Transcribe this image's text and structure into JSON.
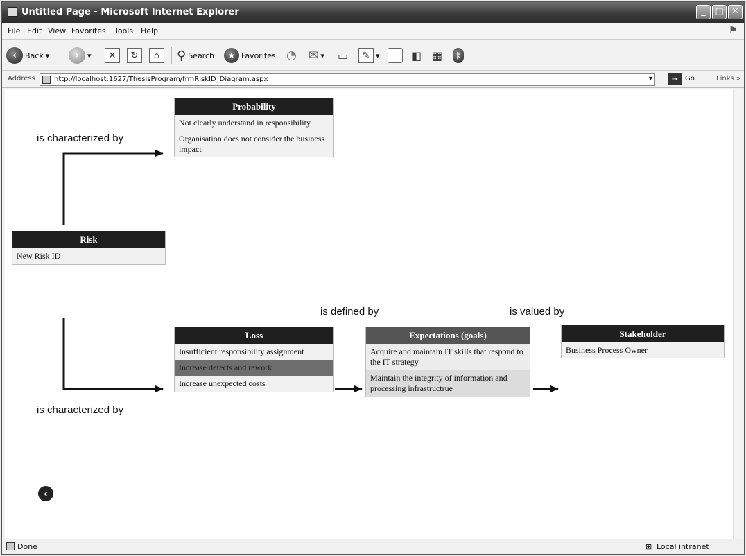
{
  "window": {
    "title": "Untitled Page - Microsoft Internet Explorer",
    "buttons": [
      "_",
      "□",
      "✕"
    ]
  },
  "menu": [
    "File",
    "Edit",
    "View",
    "Favorites",
    "Tools",
    "Help"
  ],
  "toolbar": {
    "back": "Back",
    "search": "Search",
    "favorites": "Favorites"
  },
  "address": {
    "label": "Address",
    "url": "http://localhost:1627/ThesisProgram/frmRiskID_Diagram.aspx",
    "go": "Go",
    "links": "Links »"
  },
  "diagram": {
    "risk": {
      "title": "Risk",
      "rows": [
        "New Risk ID"
      ]
    },
    "probability": {
      "title": "Probability",
      "rows": [
        "Not clearly understand in responsibility",
        "Organisation does not consider the business impact"
      ]
    },
    "loss": {
      "title": "Loss",
      "rows": [
        "Insufficient responsibility assignment",
        "Increase defects and rework",
        "Increase unexpected costs"
      ]
    },
    "expectations": {
      "title": "Expectations (goals)",
      "rows": [
        "Acquire and maintain IT skills that respond to the IT strategy",
        "Maintain the integrity of information and processing infrastructrue"
      ]
    },
    "stakeholder": {
      "title": "Stakeholder",
      "rows": [
        "Business Process Owner"
      ]
    },
    "labels": {
      "characterized_top": "is characterized by",
      "characterized_bottom": "is characterized by",
      "defined_by": "is defined by",
      "valued_by": "is valued by"
    },
    "back_icon": "back-arrow-icon"
  },
  "status": {
    "text": "Done",
    "zone": "Local intranet"
  }
}
